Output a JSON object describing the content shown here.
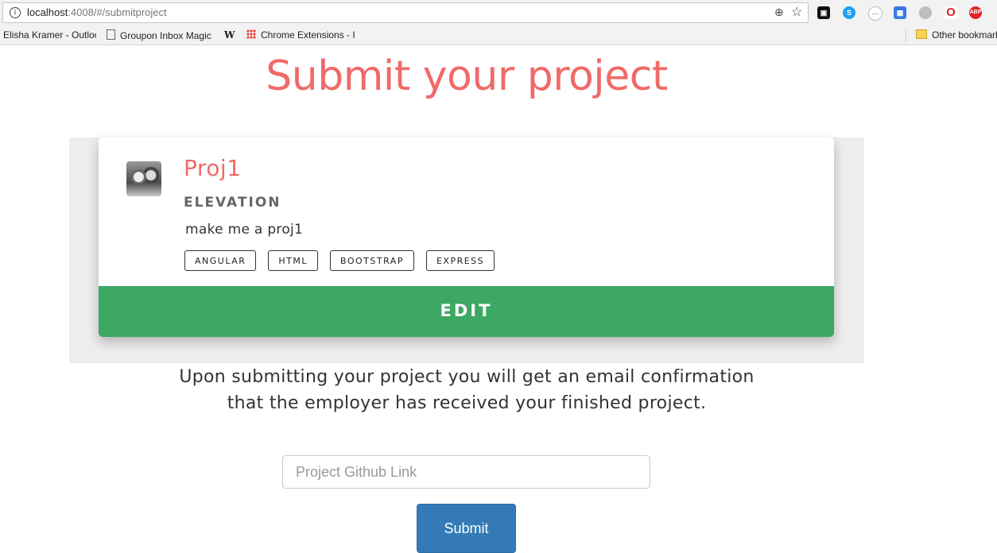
{
  "browser": {
    "url_host": "localhost",
    "url_path": ":4008/#/submitproject",
    "bookmarks": [
      {
        "label": "Elisha Kramer - Outloo"
      },
      {
        "label": "Groupon Inbox Magic"
      },
      {
        "label": "Chrome Extensions - I"
      },
      {
        "label": "Other bookmarks"
      }
    ],
    "extensions": [
      {
        "name": "terminal-extension-icon",
        "text": "",
        "color": "#111111"
      },
      {
        "name": "skype-extension-icon",
        "text": "S",
        "color": "#1da1f2"
      },
      {
        "name": "circle-extension-icon",
        "text": "",
        "color": "#cccccc"
      },
      {
        "name": "translate-extension-icon",
        "text": "",
        "color": "#3b78e7"
      },
      {
        "name": "fingerprint-extension-icon",
        "text": "",
        "color": "#999999"
      },
      {
        "name": "opera-extension-icon",
        "text": "O",
        "color": "#e01e2b"
      },
      {
        "name": "adblock-extension-icon",
        "text": "ABP",
        "color": "#e0242b"
      }
    ]
  },
  "page": {
    "title": "Submit your project",
    "info_line1": "Upon submitting your project you will get an email confirmation",
    "info_line2": "that the employer has received your finished project."
  },
  "project": {
    "name": "Proj1",
    "company": "ELEVATION",
    "description": "make me a proj1",
    "tags": [
      "ANGULAR",
      "HTML",
      "BOOTSTRAP",
      "EXPRESS"
    ],
    "edit_label": "EDIT"
  },
  "form": {
    "github_placeholder": "Project Github Link",
    "github_value": "",
    "submit_label": "Submit"
  },
  "colors": {
    "title": "#f06a68",
    "edit_button": "#3da863",
    "submit_button": "#337ab7"
  }
}
